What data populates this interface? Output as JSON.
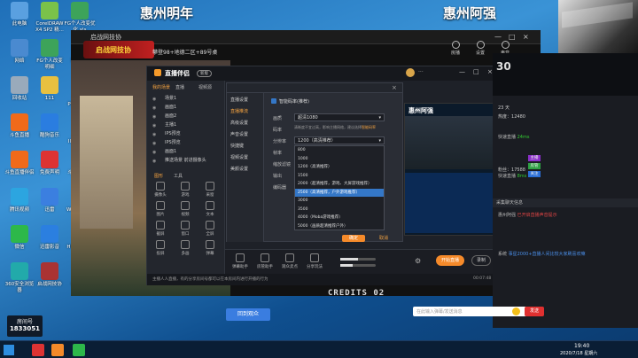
{
  "overlay": {
    "left_title": "惠州明年",
    "right_title": "惠州阿强"
  },
  "desktop_icons": [
    {
      "label": "此电脑",
      "color": "#5aa0e0"
    },
    {
      "label": "CorelDRAW X4 SP2 精...",
      "color": "#7ac24a"
    },
    {
      "label": "FG个人改变优化.xls",
      "color": "#3da35a"
    },
    {
      "label": "网络",
      "color": "#4a8ad0"
    },
    {
      "label": "FG个人改变 明细",
      "color": "#3da35a"
    },
    {
      "label": "腾讯QQ",
      "color": "#222"
    },
    {
      "label": "回收站",
      "color": "#9ab"
    },
    {
      "label": "111",
      "color": "#e8c040"
    },
    {
      "label": "Adobe Photosh...",
      "color": "#1b4d8f"
    },
    {
      "label": "斗鱼直播",
      "color": "#f06a1a"
    },
    {
      "label": "酷狗音乐",
      "color": "#2a7de0"
    },
    {
      "label": "Adobe Illustrat...",
      "color": "#e07a10"
    },
    {
      "label": "斗鱼直播伴侣",
      "color": "#f06a1a"
    },
    {
      "label": "免费声明",
      "color": "#d33"
    },
    {
      "label": "斗鱼新版本",
      "color": "#3a6"
    },
    {
      "label": "腾讯视频",
      "color": "#2ca5e0"
    },
    {
      "label": "迅雷",
      "color": "#3b7fe0"
    },
    {
      "label": "WPS Office",
      "color": "#c33"
    },
    {
      "label": "微信",
      "color": "#2db84a"
    },
    {
      "label": "迅雷影音",
      "color": "#2b7fe0"
    },
    {
      "label": "HP方手机...",
      "color": "#777"
    },
    {
      "label": "360安全浏览器",
      "color": "#2aa"
    },
    {
      "label": "启战网技协",
      "color": "#a33"
    },
    {
      "label": "QQ音乐",
      "color": "#e8c030"
    }
  ],
  "room": {
    "label": "房间号",
    "number": "1833051"
  },
  "game": {
    "title": "攀登98+地德二区+89号桌",
    "logo": "启战网技协",
    "status_icons": [
      {
        "label": "房播",
        "name": "broadcast-icon"
      },
      {
        "label": "设置",
        "name": "gear-icon"
      },
      {
        "label": "声音",
        "name": "speaker-icon"
      }
    ],
    "credits": "CREDITS 02",
    "bottom_button": "回到观众"
  },
  "obs": {
    "title": "直播伴侣",
    "tag": "新版",
    "tabs": [
      "我的场景",
      "直播",
      "视频源"
    ],
    "scenes": [
      "场景1",
      "画面1",
      "画面2",
      "主播1",
      "IPS预览",
      "IPS预览",
      "画面1",
      "推送场景 前进摄像头"
    ],
    "tools_header": [
      "图形",
      "工具"
    ],
    "tools": [
      "摄像头",
      "游戏",
      "采窗",
      "图片",
      "视频",
      "文本",
      "截屏",
      "窗口",
      "全屏",
      "投屏",
      "多画",
      "弹幕"
    ],
    "bottom_tools": [
      "弹幕助手",
      "房管助手",
      "观众卖点",
      "分享玩法"
    ],
    "start_button": "开始直播",
    "record_button": "录制",
    "status": "主播人人直播，有的分享房间号都可以在本房间内进行开播的行为",
    "time": "00:07:48",
    "dots": "···",
    "window_controls": [
      "—",
      "□",
      "×"
    ]
  },
  "settings": {
    "menu": [
      "直播设置",
      "直播推流",
      "高级设置",
      "声音设置",
      "快捷键",
      "视频设置",
      "美颜设置"
    ],
    "checkbox_label": "智能码率(推荐)",
    "rows": [
      "画质",
      "码率",
      "分辨率",
      "帧率",
      "缩放滤镜",
      "输出",
      "编码器"
    ],
    "select_value": "超清1080",
    "tip": "清晰度不宜过高，影响主播网络，建议选择",
    "tip_link": "智能码率",
    "dropdown_header": "1200（高清推荐）",
    "options": [
      "800",
      "1000",
      "1200（高清推荐）",
      "1500",
      "2000（超清推荐，游戏、大屏游戏推荐）",
      "2500（高清推荐，户外游戏推荐）",
      "3000",
      "3500",
      "4000（Moba游戏推荐）",
      "5000（画质超清推荐户外）"
    ],
    "selected_index": 5,
    "ok_button": "确定",
    "cancel_button": "取消"
  },
  "preview": {
    "title": "惠州阿强"
  },
  "chat": {
    "viewer_label": "热度",
    "viewer_count": "12480",
    "fans_label": "粉丝",
    "fans_count": "17588",
    "lines": [
      {
        "user": "快速直播",
        "text": "24ms",
        "color": "#3c3"
      },
      {
        "user": "快速直播",
        "text": "8ms",
        "color": "#3c3"
      },
      {
        "user": "惠州阿强",
        "text": "已开启直播声音提示",
        "color": "#d44"
      },
      {
        "user": "系统",
        "text": "事星2000+直播人间比较大家刷喜欢嘛",
        "color": "#4a8ee8"
      }
    ],
    "side_labels": [
      "23 天",
      "主播",
      "房管",
      "关注"
    ],
    "notice": "采集聊天信息",
    "input_placeholder": "在此输入弹幕/发送消息",
    "send_button": "发送"
  },
  "taskbar": {
    "time": "19:40",
    "date": "2020/7/18 星期六"
  }
}
